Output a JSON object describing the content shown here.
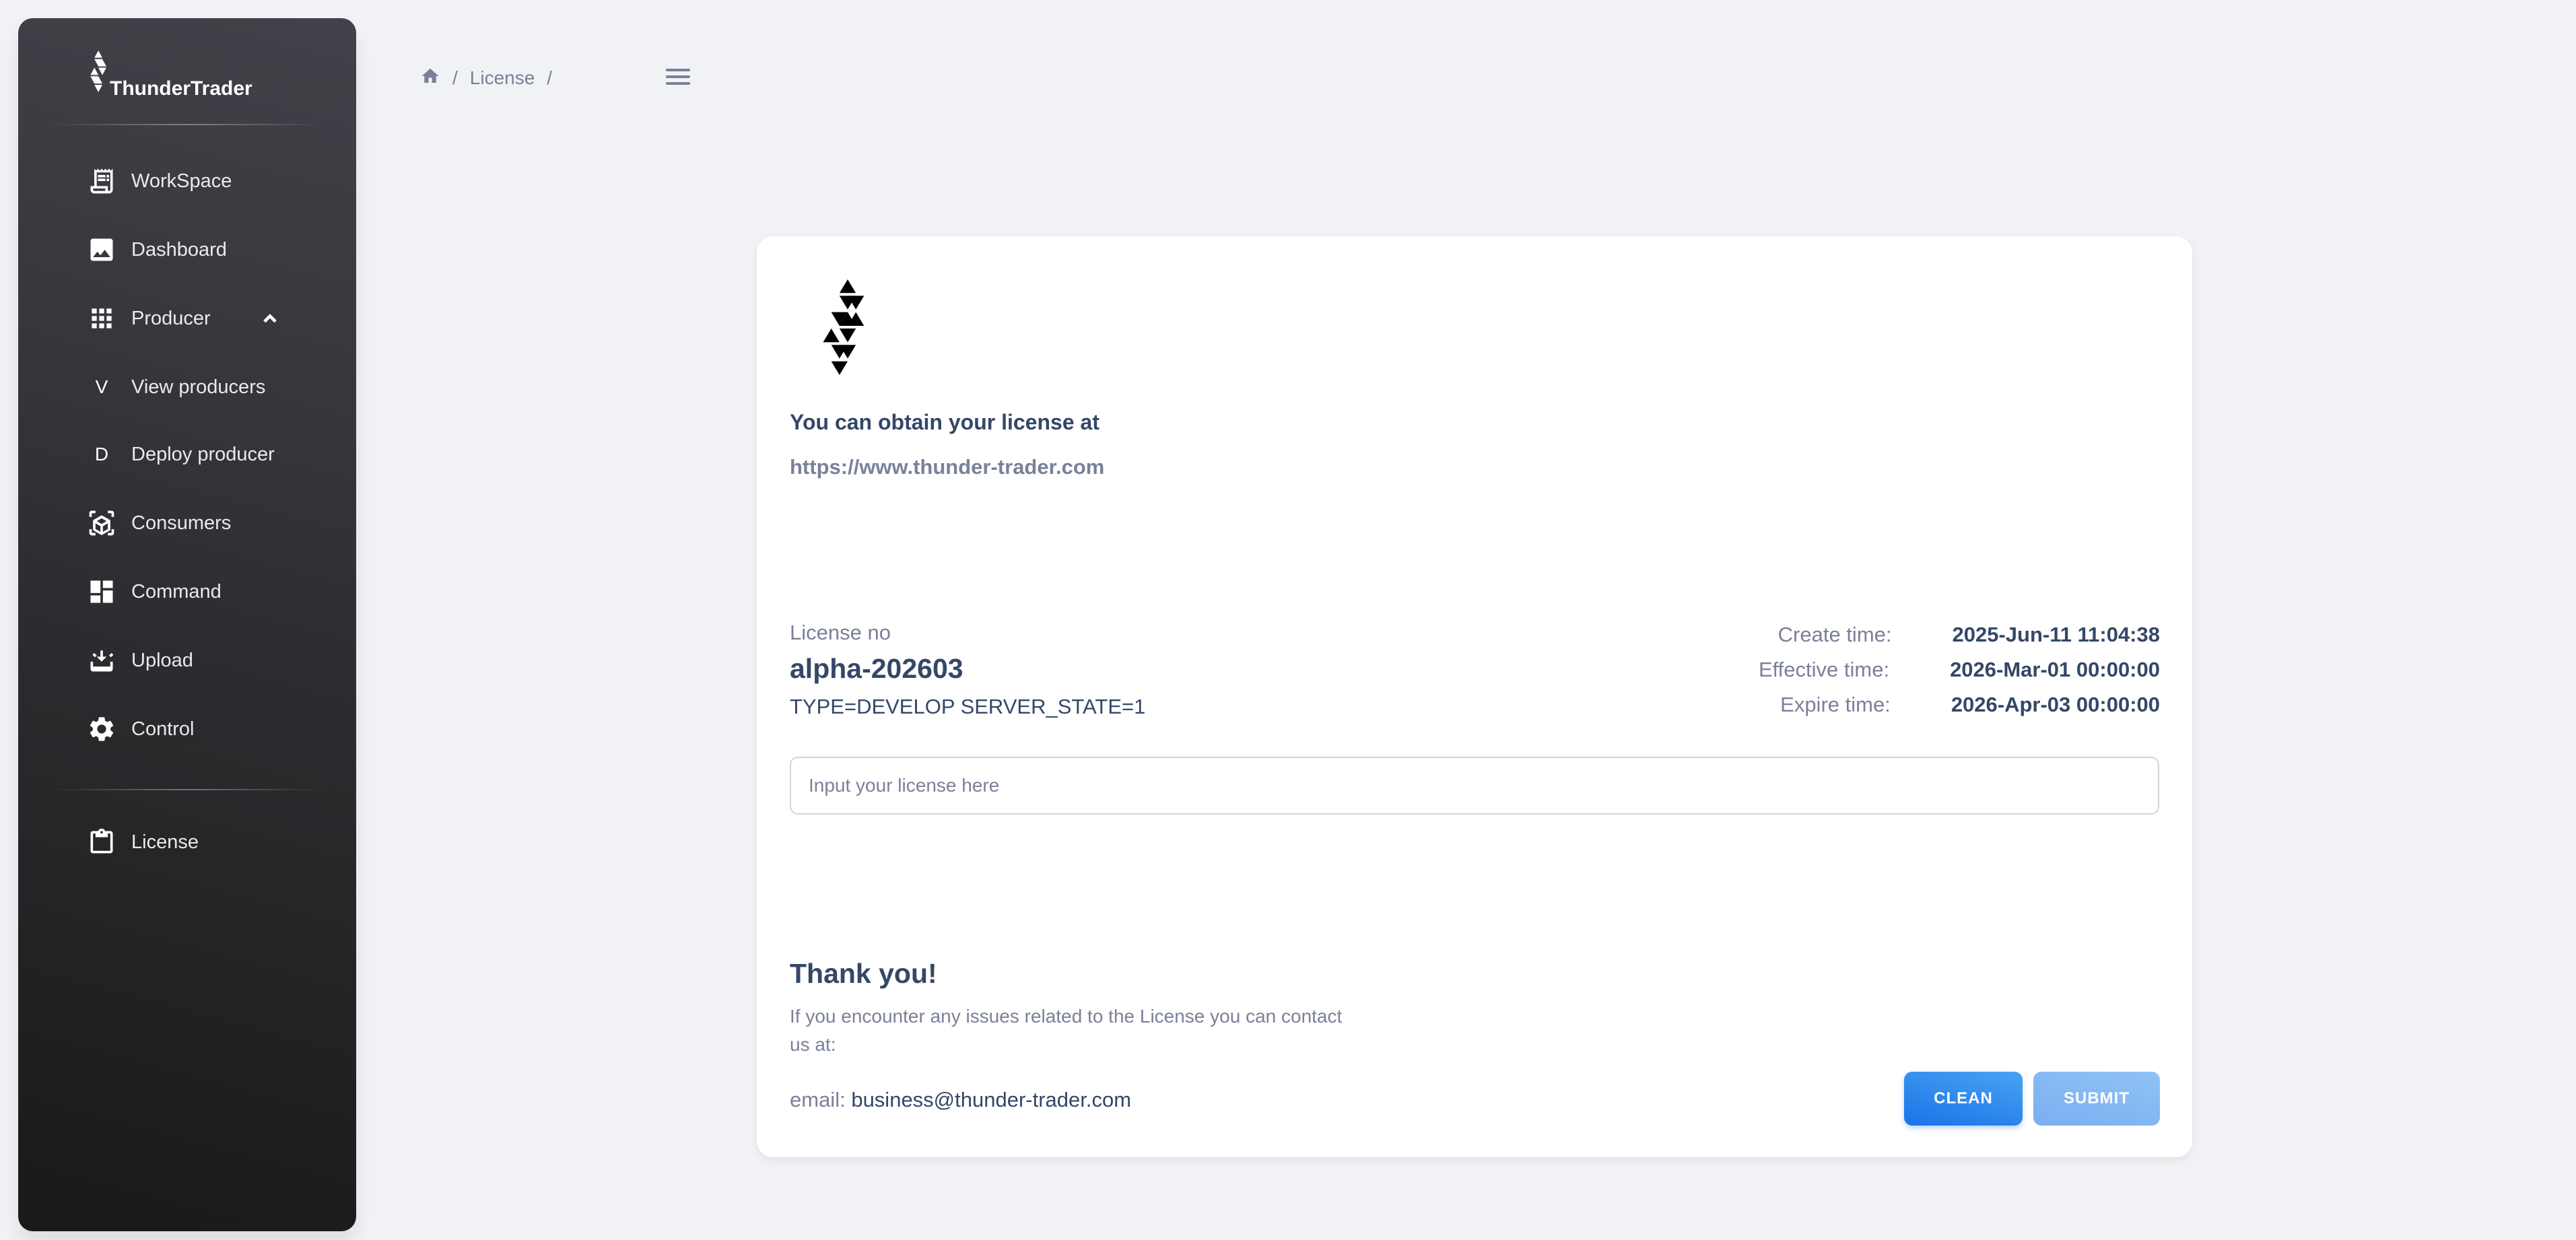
{
  "sidebar": {
    "brand": "ThunderTrader",
    "items": [
      {
        "label": "WorkSpace",
        "icon": "receipt-icon"
      },
      {
        "label": "Dashboard",
        "icon": "image-icon"
      },
      {
        "label": "Producer",
        "icon": "apps-grid-icon",
        "expanded": true
      },
      {
        "label": "View producers",
        "letter": "V"
      },
      {
        "label": "Deploy producer",
        "letter": "D"
      },
      {
        "label": "Consumers",
        "icon": "cube-scan-icon"
      },
      {
        "label": "Command",
        "icon": "dashboard-icon"
      },
      {
        "label": "Upload",
        "icon": "inbox-download-icon"
      },
      {
        "label": "Control",
        "icon": "gear-icon"
      },
      {
        "label": "License",
        "icon": "clipboard-icon"
      }
    ]
  },
  "breadcrumb": {
    "home_icon": "home-icon",
    "current": "License",
    "separator": "/"
  },
  "card": {
    "obtain_title": "You can obtain your license at",
    "obtain_link": "https://www.thunder-trader.com",
    "license_label": "License no",
    "license_no": "alpha-202603",
    "license_type": "TYPE=DEVELOP SERVER_STATE=1",
    "times": [
      {
        "label": "Create time:",
        "value": "2025-Jun-11 11:04:38"
      },
      {
        "label": "Effective time:",
        "value": "2026-Mar-01 00:00:00"
      },
      {
        "label": "Expire time:",
        "value": "2026-Apr-03 00:00:00"
      }
    ],
    "input": {
      "value": "",
      "placeholder": "Input your license here"
    },
    "thanks": "Thank you!",
    "issues": "If you encounter any issues related to the License you can contact us at:",
    "email_label": "email:",
    "email": "business@thunder-trader.com",
    "clean_label": "CLEAN",
    "submit_label": "SUBMIT"
  },
  "colors": {
    "sidebar_dark": "#191919",
    "primary": "#1a73e8",
    "text_dark": "#344767",
    "text_muted": "#7b809a",
    "background": "#f0f2f5"
  }
}
